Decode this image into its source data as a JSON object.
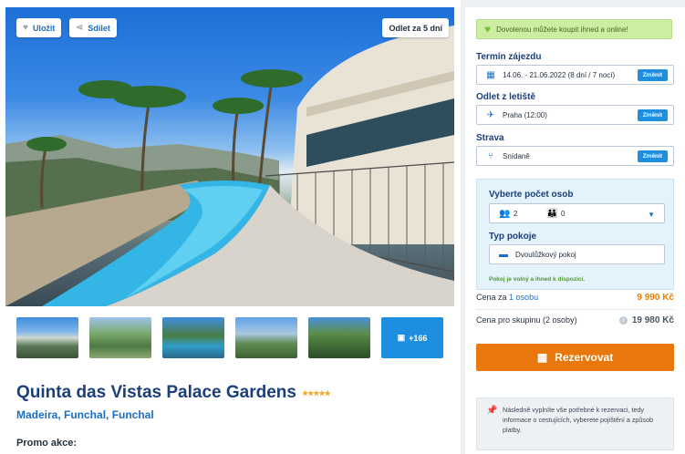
{
  "hero": {
    "save_label": "Uložit",
    "share_label": "Sdílet",
    "departure_badge": "Odlet za 5 dní"
  },
  "gallery": {
    "more_label": "+166"
  },
  "hotel": {
    "name": "Quinta das Vistas Palace Gardens",
    "stars": 5,
    "stars_display": "★★★★★",
    "location": "Madeira, Funchal, Funchal",
    "promo_label": "Promo akce:"
  },
  "booking": {
    "banner": "Dovolenou můžete koupit ihned a online!",
    "term_label": "Termín zájezdu",
    "term_value": "14.06. - 21.06.2022 (8 dní / 7 nocí)",
    "change_label": "Změnit",
    "airport_label": "Odlet z letiště",
    "airport_value": "Praha (12:00)",
    "board_label": "Strava",
    "board_value": "Snídaně",
    "persons_label": "Vyberte počet osob",
    "adults": "2",
    "children": "0",
    "room_label": "Typ pokoje",
    "room_value": "Dvoulůžkový pokoj",
    "availability": "Pokoj je volný a ihned k dispozici.",
    "price_per_person_label": "Cena za",
    "price_per_person_qty": "1 osobu",
    "price_per_person": "9 990 Kč",
    "price_group_label": "Cena pro skupinu (2 osoby)",
    "price_group": "19 980 Kč",
    "reserve_label": "Rezervovat",
    "note": "Následně vyplníte vše potřebné k rezervaci, tedy informace o cestujících, vyberete pojištění a způsob platby."
  },
  "colors": {
    "accent": "#1e8fe0",
    "reserve": "#e8780c",
    "price": "#e67e00",
    "title": "#1b3f7a"
  }
}
